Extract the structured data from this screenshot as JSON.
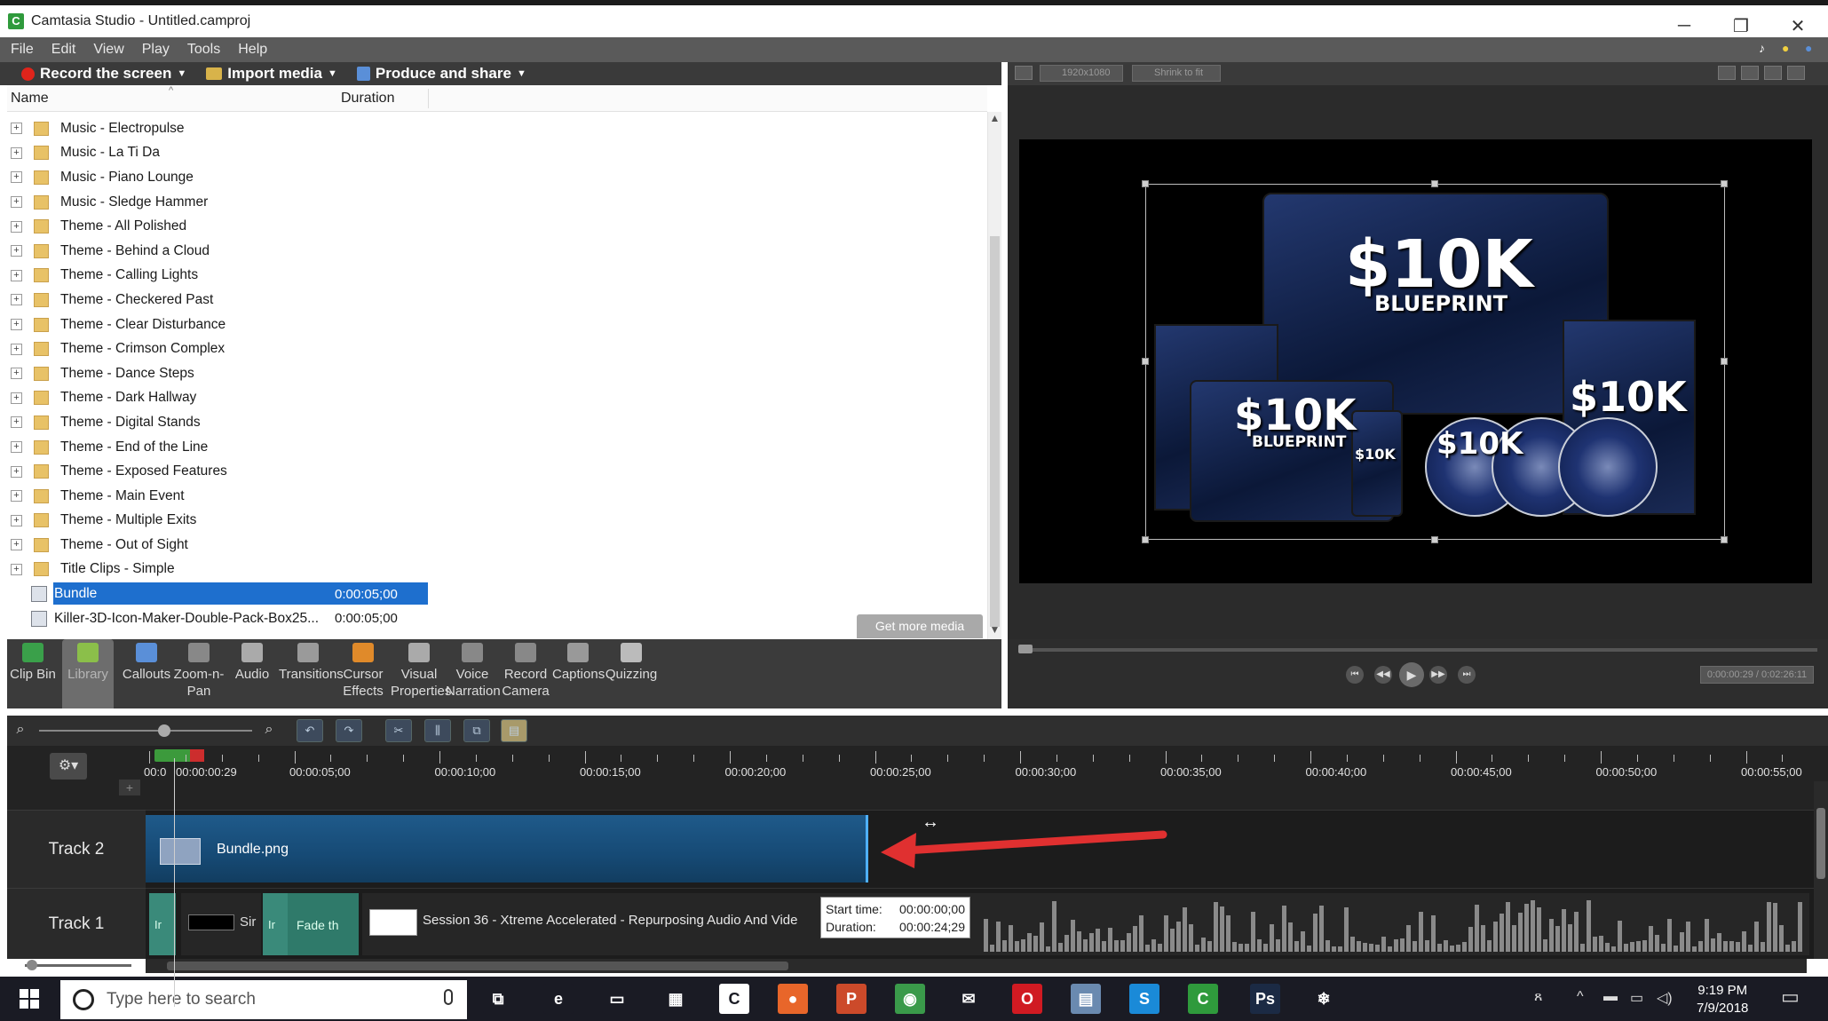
{
  "window": {
    "title": "Camtasia Studio - Untitled.camproj",
    "minimize_glyph": "─",
    "restore_glyph": "❐",
    "close_glyph": "✕"
  },
  "menu": [
    "File",
    "Edit",
    "View",
    "Play",
    "Tools",
    "Help"
  ],
  "toolbar": {
    "record": "Record the screen",
    "import": "Import media",
    "produce": "Produce and share"
  },
  "clip_bin": {
    "col_name": "Name",
    "col_duration": "Duration",
    "items": [
      {
        "label": "Music - Electropulse"
      },
      {
        "label": "Music - La Ti Da"
      },
      {
        "label": "Music - Piano Lounge"
      },
      {
        "label": "Music - Sledge Hammer"
      },
      {
        "label": "Theme - All Polished"
      },
      {
        "label": "Theme - Behind a Cloud"
      },
      {
        "label": "Theme - Calling Lights"
      },
      {
        "label": "Theme - Checkered Past"
      },
      {
        "label": "Theme - Clear Disturbance"
      },
      {
        "label": "Theme - Crimson Complex"
      },
      {
        "label": "Theme - Dance Steps"
      },
      {
        "label": "Theme - Dark Hallway"
      },
      {
        "label": "Theme - Digital Stands"
      },
      {
        "label": "Theme - End of the Line"
      },
      {
        "label": "Theme - Exposed Features"
      },
      {
        "label": "Theme - Main Event"
      },
      {
        "label": "Theme - Multiple Exits"
      },
      {
        "label": "Theme - Out of Sight"
      },
      {
        "label": "Title Clips - Simple"
      }
    ],
    "files": [
      {
        "label": "Bundle",
        "duration": "0:00:05;00",
        "selected": true
      },
      {
        "label": "Killer-3D-Icon-Maker-Double-Pack-Box25...",
        "duration": "0:00:05;00",
        "selected": false
      }
    ],
    "get_more": "Get more media"
  },
  "tasks": [
    {
      "label": "Clip Bin",
      "color": "#3aa04a"
    },
    {
      "label": "Library",
      "color": "#8bbf4a",
      "active": true
    },
    {
      "label": "Callouts",
      "color": "#5a8fd8"
    },
    {
      "label": "Zoom-n-\nPan",
      "color": "#888888"
    },
    {
      "label": "Audio",
      "color": "#aaaaaa"
    },
    {
      "label": "Transitions",
      "color": "#9a9a9a"
    },
    {
      "label": "Cursor\nEffects",
      "color": "#e08a2a"
    },
    {
      "label": "Visual\nProperties",
      "color": "#aaaaaa"
    },
    {
      "label": "Voice\nNarration",
      "color": "#888888"
    },
    {
      "label": "Record\nCamera",
      "color": "#888888"
    },
    {
      "label": "Captions",
      "color": "#999999"
    },
    {
      "label": "Quizzing",
      "color": "#bbbbbb"
    }
  ],
  "preview": {
    "resolution": "1920x1080",
    "zoom": "Shrink to fit",
    "timecode": "0:00:00:29 / 0:02:26:11",
    "product_title": "$10K",
    "product_sub": "BLUEPRINT"
  },
  "timeline": {
    "ruler_labels": [
      "00:00:00:29",
      "00:00:05;00",
      "00:00:10;00",
      "00:00:15;00",
      "00:00:20;00",
      "00:00:25;00",
      "00:00:30;00",
      "00:00:35;00",
      "00:00:40;00",
      "00:00:45;00",
      "00:00:50;00",
      "00:00:55;00"
    ],
    "ruler_start": "00:0",
    "tracks": [
      {
        "name": "Track 2",
        "clip": "Bundle.png"
      },
      {
        "name": "Track 1",
        "clip": "Session 36 - Xtreme Accelerated - Repurposing Audio And Vide"
      }
    ],
    "track1_small": [
      "Ir",
      "Sir",
      "Ir",
      "Fade th"
    ],
    "tooltip": {
      "start_label": "Start time:",
      "start_value": "00:00:00;00",
      "duration_label": "Duration:",
      "duration_value": "00:00:24;29"
    }
  },
  "taskbar": {
    "search_placeholder": "Type here to search",
    "time": "9:19 PM",
    "date": "7/9/2018",
    "apps": [
      {
        "name": "task-view",
        "color": "#1a1b24",
        "glyph": "⧉"
      },
      {
        "name": "edge",
        "color": "#1a1b24",
        "glyph": "e"
      },
      {
        "name": "file-explorer",
        "color": "#1a1b24",
        "glyph": "▭"
      },
      {
        "name": "store",
        "color": "#1a1b24",
        "glyph": "▦"
      },
      {
        "name": "camtasia-recorder",
        "color": "#ffffff",
        "glyph": "C"
      },
      {
        "name": "firefox",
        "color": "#e8662a",
        "glyph": "●"
      },
      {
        "name": "powerpoint",
        "color": "#cc4a2a",
        "glyph": "P"
      },
      {
        "name": "chrome",
        "color": "#3a9a4a",
        "glyph": "◉"
      },
      {
        "name": "mail",
        "color": "#1a1b24",
        "glyph": "✉"
      },
      {
        "name": "opera",
        "color": "#d01a22",
        "glyph": "O"
      },
      {
        "name": "notes",
        "color": "#6a8ab0",
        "glyph": "▤"
      },
      {
        "name": "skype",
        "color": "#1a8ad8",
        "glyph": "S"
      },
      {
        "name": "camtasia-studio",
        "color": "#2f9a3c",
        "glyph": "C"
      },
      {
        "name": "photoshop",
        "color": "#1b2a44",
        "glyph": "Ps"
      },
      {
        "name": "snowflake-app",
        "color": "#1a1b24",
        "glyph": "❄"
      }
    ]
  }
}
